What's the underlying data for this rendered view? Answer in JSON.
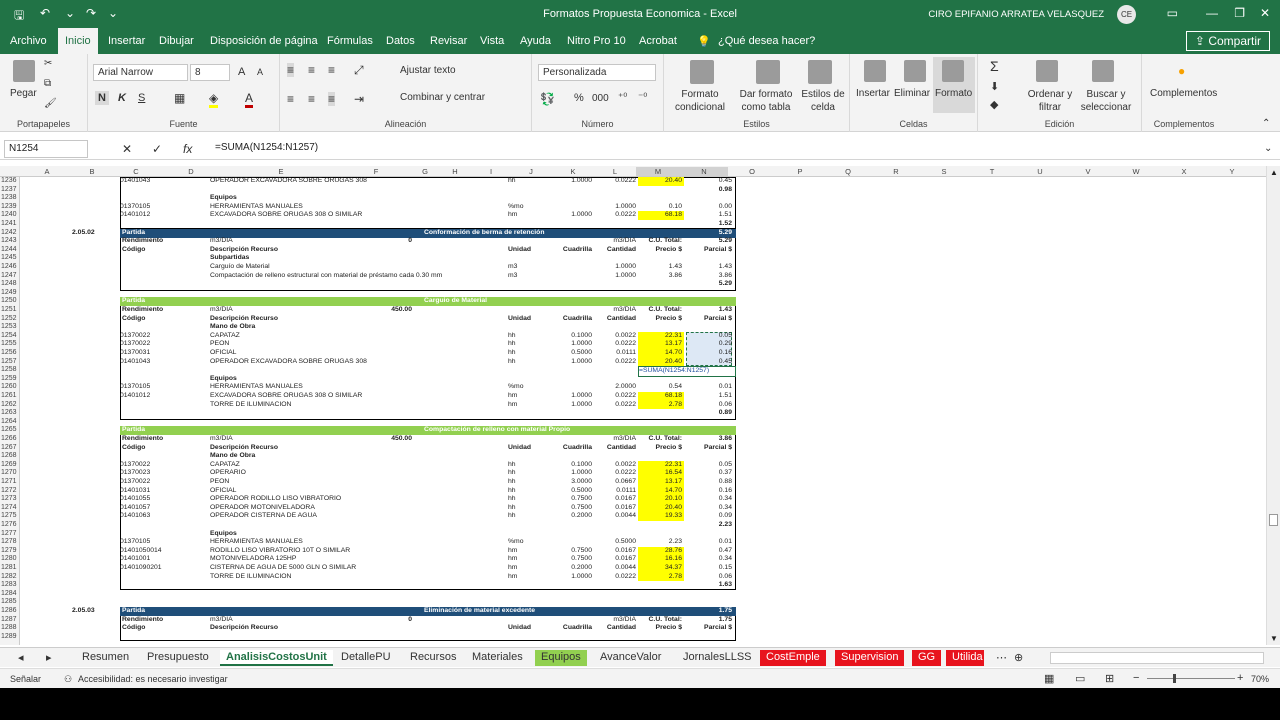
{
  "window": {
    "title": "Formatos Propuesta Economica  -  Excel",
    "user": "CIRO EPIFANIO ARRATEA VELASQUEZ",
    "initials": "CE"
  },
  "menu": {
    "tabs": [
      "Archivo",
      "Inicio",
      "Insertar",
      "Dibujar",
      "Disposición de página",
      "Fórmulas",
      "Datos",
      "Revisar",
      "Vista",
      "Ayuda",
      "Nitro Pro 10",
      "Acrobat"
    ],
    "tellme": "¿Qué desea hacer?",
    "share": "Compartir"
  },
  "ribbon": {
    "clipboard": {
      "label": "Portapapeles",
      "paste": "Pegar"
    },
    "font": {
      "label": "Fuente",
      "name": "Arial Narrow",
      "size": "8",
      "bold": "N",
      "italic": "K",
      "underline": "S"
    },
    "alignment": {
      "label": "Alineación",
      "wrap": "Ajustar texto",
      "merge": "Combinar y centrar"
    },
    "number": {
      "label": "Número",
      "format": "Personalizada",
      "pct": "%",
      "comma": "000"
    },
    "styles": {
      "label": "Estilos",
      "cond": "Formato condicional",
      "table": "Dar formato como tabla",
      "cell": "Estilos de celda"
    },
    "cells": {
      "label": "Celdas",
      "insert": "Insertar",
      "delete": "Eliminar",
      "format": "Formato"
    },
    "editing": {
      "label": "Edición",
      "sort": "Ordenar y filtrar",
      "find": "Buscar y seleccionar"
    },
    "addins": {
      "label": "Complementos",
      "btn": "Complementos"
    }
  },
  "formula": {
    "namebox": "N1254",
    "content": "=SUMA(N1254:N1257)"
  },
  "columns": [
    "A",
    "B",
    "C",
    "D",
    "E",
    "F",
    "G",
    "H",
    "I",
    "J",
    "K",
    "L",
    "M",
    "N",
    "O",
    "P",
    "Q",
    "R",
    "S",
    "T",
    "U",
    "V",
    "W",
    "X",
    "Y"
  ],
  "rows": [
    "1236",
    "1237",
    "1238",
    "1239",
    "1240",
    "1241",
    "1242",
    "1243",
    "1244",
    "1245",
    "1246",
    "1247",
    "1248",
    "1249",
    "1250",
    "1251",
    "1252",
    "1253",
    "1254",
    "1255",
    "1256",
    "1257",
    "1258",
    "1259",
    "1260",
    "1261",
    "1262",
    "1263",
    "1264",
    "1265",
    "1266",
    "1267",
    "1268",
    "1269",
    "1270",
    "1271",
    "1272",
    "1273",
    "1274",
    "1275",
    "1276",
    "1277",
    "1278",
    "1279",
    "1280",
    "1281",
    "1282",
    "1283",
    "1284",
    "1285",
    "1286",
    "1287",
    "1288",
    "1289"
  ],
  "cells": {
    "r1236a": "01401043",
    "r1236b": "OPERADOR EXCAVADORA SOBRE ORUGAS 308",
    "r1236c": "hh",
    "r1236d": "1.0000",
    "r1236e": "0.0222",
    "r1236f": "20.40",
    "r1236g": "0.45",
    "r1237g": "0.98",
    "r1238": "Equipos",
    "r1239a": "01370105",
    "r1239b": "HERRAMIENTAS MANUALES",
    "r1239c": "%mo",
    "r1239d": "1.0000",
    "r1239e": "0.10",
    "r1239f": "0.00",
    "r1240a": "01401012",
    "r1240b": "EXCAVADORA SOBRE ORUGAS 308 O SIMILAR",
    "r1240c": "hm",
    "r1240d": "1.0000",
    "r1240e": "0.0222",
    "r1240f": "68.18",
    "r1240g": "1.51",
    "r1241g": "1.52",
    "s2code": "2.05.02",
    "s2title": "Conformación de berma de retención",
    "s2total": "5.29",
    "s2rend": "Rendimiento",
    "s2unit": "m3/DIA",
    "s2zero": "0",
    "s2unit2": "m3/DIA",
    "s2cu": "C.U. Total:",
    "s2cuv": "5.29",
    "hdr_cod": "Código",
    "hdr_desc": "Descripción Recurso",
    "hdr_und": "Unidad",
    "hdr_cuad": "Cuadrilla",
    "hdr_cant": "Cantidad",
    "hdr_precio": "Precio $",
    "hdr_parcial": "Parcial $",
    "s2sub": "Subpartidas",
    "s2r1b": "Carguío de Material",
    "s2r1c": "m3",
    "s2r1e": "1.0000",
    "s2r1f": "1.43",
    "s2r1g": "1.43",
    "s2r2b": "Compactación de relleno estructural con material de préstamo cada 0.30 mm",
    "s2r2c": "m3",
    "s2r2e": "1.0000",
    "s2r2f": "3.86",
    "s2r2g": "3.86",
    "s2tot": "5.29",
    "partida": "Partida",
    "s3title": "Carguio de Material",
    "s3rend": "Rendimiento",
    "s3unit": "m3/DIA",
    "s3rv": "450.00",
    "s3unit2": "m3/DIA",
    "s3cu": "C.U. Total:",
    "s3cuv": "1.43",
    "mano": "Mano de Obra",
    "s3m1a": "01370022",
    "s3m1b": "CAPATAZ",
    "s3m1c": "hh",
    "s3m1d": "0.1000",
    "s3m1e": "0.0022",
    "s3m1f": "22.31",
    "s3m1g": "0.05",
    "s3m2a": "01370022",
    "s3m2b": "PEON",
    "s3m2c": "hh",
    "s3m2d": "1.0000",
    "s3m2e": "0.0222",
    "s3m2f": "13.17",
    "s3m2g": "0.29",
    "s3m3a": "01370031",
    "s3m3b": "OFICIAL",
    "s3m3c": "hh",
    "s3m3d": "0.5000",
    "s3m3e": "0.0111",
    "s3m3f": "14.70",
    "s3m3g": "0.16",
    "s3m4a": "01401043",
    "s3m4b": "OPERADOR EXCAVADORA SOBRE ORUGAS 308",
    "s3m4c": "hh",
    "s3m4d": "1.0000",
    "s3m4e": "0.0222",
    "s3m4f": "20.40",
    "s3m4g": "0.45",
    "s3formula": "=SUMA(N1254:N1257)",
    "equipos": "Equipos",
    "s3e1a": "01370105",
    "s3e1b": "HERRAMIENTAS MANUALES",
    "s3e1c": "%mo",
    "s3e1d": "2.0000",
    "s3e1e": "0.54",
    "s3e1f": "0.01",
    "s3e2a": "01401012",
    "s3e2b": "EXCAVADORA SOBRE ORUGAS 308 O SIMILAR",
    "s3e2c": "hm",
    "s3e2d": "1.0000",
    "s3e2e": "0.0222",
    "s3e2f": "68.18",
    "s3e2g": "1.51",
    "s3e3b": "TORRE DE ILUMINACION",
    "s3e3c": "hm",
    "s3e3d": "1.0000",
    "s3e3e": "0.0222",
    "s3e3f": "2.78",
    "s3e3g": "0.06",
    "s3tot": "0.89",
    "s4title": "Compactación de relleno con material Propio",
    "s4rend": "Rendimiento",
    "s4unit": "m3/DIA",
    "s4rv": "450.00",
    "s4unit2": "m3/DIA",
    "s4cu": "C.U. Total:",
    "s4cuv": "3.86",
    "s4m": [
      [
        "01370022",
        "CAPATAZ",
        "hh",
        "0.1000",
        "0.0022",
        "22.31",
        "0.05"
      ],
      [
        "01370023",
        "OPERARIO",
        "hh",
        "1.0000",
        "0.0222",
        "16.54",
        "0.37"
      ],
      [
        "01370022",
        "PEON",
        "hh",
        "3.0000",
        "0.0667",
        "13.17",
        "0.88"
      ],
      [
        "01401031",
        "OFICIAL",
        "hh",
        "0.5000",
        "0.0111",
        "14.70",
        "0.16"
      ],
      [
        "01401055",
        "OPERADOR RODILLO LISO VIBRATORIO",
        "hh",
        "0.7500",
        "0.0167",
        "20.10",
        "0.34"
      ],
      [
        "01401057",
        "OPERADOR MOTONIVELADORA",
        "hh",
        "0.7500",
        "0.0167",
        "20.40",
        "0.34"
      ],
      [
        "01401063",
        "OPERADOR CISTERNA DE AGUA",
        "hh",
        "0.2000",
        "0.0044",
        "19.33",
        "0.09"
      ]
    ],
    "s4mtot": "2.23",
    "s4e": [
      [
        "01370105",
        "HERRAMIENTAS MANUALES",
        "%mo",
        "",
        "0.5000",
        "2.23",
        "0.01"
      ],
      [
        "01401050014",
        "RODILLO LISO VIBRATORIO 10T O SIMILAR",
        "hm",
        "0.7500",
        "0.0167",
        "28.76",
        "0.47"
      ],
      [
        "01401001",
        "MOTONIVELADORA 125HP",
        "hm",
        "0.7500",
        "0.0167",
        "16.16",
        "0.34"
      ],
      [
        "01401090201",
        "CISTERNA DE AGUA DE 5000 GLN O SIMILAR",
        "hm",
        "0.2000",
        "0.0044",
        "34.37",
        "0.15"
      ],
      [
        "",
        "TORRE DE ILUMINACION",
        "hm",
        "1.0000",
        "0.0222",
        "2.78",
        "0.06"
      ]
    ],
    "s4tot": "1.63",
    "s5code": "2.05.03",
    "s5title": "Eliminación de material excedente",
    "s5total": "1.75",
    "s5rend": "Rendimiento",
    "s5unit": "m3/DIA",
    "s5zero": "0",
    "s5unit2": "m3/DIA",
    "s5cu": "C.U. Total:",
    "s5cuv": "1.75"
  },
  "sheettabs": [
    "Resumen",
    "Presupuesto",
    "AnalisisCostosUnit",
    "DetallePU",
    "Recursos",
    "Materiales",
    "Equipos",
    "AvanceValor",
    "JornalesLLSS",
    "CostEmple",
    "Supervision",
    "GG",
    "Utilida"
  ],
  "status": {
    "mode": "Señalar",
    "accessibility": "Accesibilidad: es necesario investigar",
    "zoom": "70%"
  },
  "colors": {
    "excel_green": "#217346",
    "partida_bar": "#1f4e79",
    "header_green": "#92d050",
    "highlight": "#ffff00",
    "tab_red": "#e8141e"
  }
}
